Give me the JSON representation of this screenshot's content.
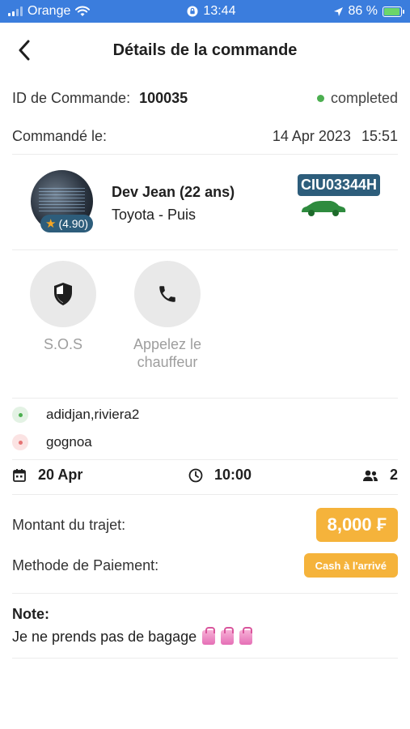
{
  "status_bar": {
    "carrier": "Orange",
    "time": "13:44",
    "battery": "86 %"
  },
  "header": {
    "title": "Détails de la commande"
  },
  "order": {
    "id_label": "ID de Commande:",
    "id_value": "100035",
    "status": "completed",
    "date_label": "Commandé le:",
    "date_value": "14 Apr 2023",
    "time_value": "15:51"
  },
  "driver": {
    "name": "Dev Jean (22 ans)",
    "vehicle": "Toyota - Puis",
    "rating": "(4.90)",
    "plate": "CIU03344H"
  },
  "actions": {
    "sos_label": "S.O.S",
    "call_label": "Appelez le chauffeur"
  },
  "locations": {
    "pickup": "adidjan,riviera2",
    "dropoff": "gognoa"
  },
  "trip": {
    "date": "20 Apr",
    "time": "10:00",
    "passengers": "2"
  },
  "payment": {
    "amount_label": "Montant du trajet:",
    "amount_value": "8,000 ₣",
    "method_label": "Methode de Paiement:",
    "method_value": "Cash à l'arrivé"
  },
  "note": {
    "title": "Note:",
    "text": "Je ne prends pas de bagage"
  },
  "colors": {
    "status_bar": "#3b7ddd",
    "accent": "#f5b33b",
    "plate": "#2d5d7b",
    "completed": "#4caf50",
    "car": "#2e8b3e"
  }
}
